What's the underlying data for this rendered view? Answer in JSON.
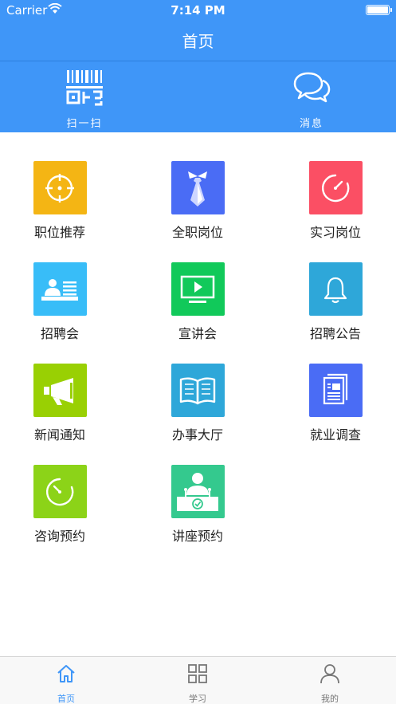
{
  "status_bar": {
    "carrier": "Carrier",
    "time": "7:14 PM"
  },
  "header": {
    "title": "首页"
  },
  "quick_actions": [
    {
      "label": "扫一扫",
      "icon": "qr-scan-icon"
    },
    {
      "label": "消息",
      "icon": "chat-bubbles-icon"
    }
  ],
  "grid": [
    {
      "label": "职位推荐",
      "icon": "target-icon",
      "color": "#f4b514"
    },
    {
      "label": "全职岗位",
      "icon": "necktie-icon",
      "color": "#4a6cf5"
    },
    {
      "label": "实习岗位",
      "icon": "clock-icon",
      "color": "#fb4f64"
    },
    {
      "label": "招聘会",
      "icon": "id-card-icon",
      "color": "#38bdf8"
    },
    {
      "label": "宣讲会",
      "icon": "video-screen-icon",
      "color": "#11c95a"
    },
    {
      "label": "招聘公告",
      "icon": "bell-icon",
      "color": "#2ea7d9"
    },
    {
      "label": "新闻通知",
      "icon": "megaphone-icon",
      "color": "#99d003"
    },
    {
      "label": "办事大厅",
      "icon": "open-book-icon",
      "color": "#2ea7d9"
    },
    {
      "label": "就业调查",
      "icon": "document-icon",
      "color": "#4a6cf5"
    },
    {
      "label": "咨询预约",
      "icon": "clock-icon",
      "color": "#8cd318"
    },
    {
      "label": "讲座预约",
      "icon": "lecturer-podium-icon",
      "color": "#34c98e"
    }
  ],
  "tabbar": {
    "items": [
      {
        "label": "首页",
        "icon": "home-icon",
        "active": true
      },
      {
        "label": "学习",
        "icon": "grid-icon",
        "active": false
      },
      {
        "label": "我的",
        "icon": "user-icon",
        "active": false
      }
    ],
    "active_color": "#3f96f8",
    "inactive_color": "#777777"
  }
}
